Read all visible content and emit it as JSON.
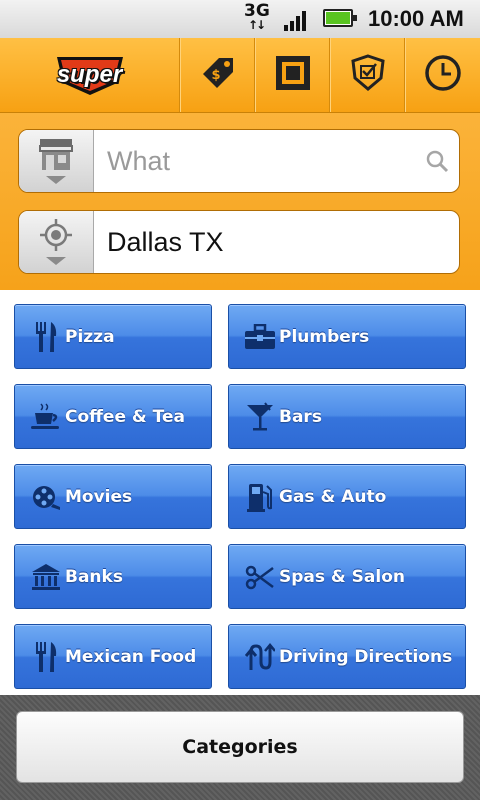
{
  "status_bar": {
    "network": "3G",
    "network_activity": "↑↓",
    "time": "10:00 AM",
    "battery_color": "#59c421"
  },
  "toolbar": {
    "logo_text": "super",
    "buttons": [
      {
        "icon": "price-tag-icon"
      },
      {
        "icon": "barcode-scan-icon"
      },
      {
        "icon": "shield-check-icon"
      },
      {
        "icon": "clock-icon"
      }
    ],
    "accent_color": "#f7a113"
  },
  "search": {
    "what_placeholder": "What",
    "what_icon": "storefront-icon",
    "where_value": "Dallas TX",
    "where_icon": "location-target-icon"
  },
  "categories": [
    {
      "label": "Pizza",
      "icon": "fork-knife-icon"
    },
    {
      "label": "Plumbers",
      "icon": "toolbox-icon"
    },
    {
      "label": "Coffee & Tea",
      "icon": "coffee-cup-icon"
    },
    {
      "label": "Bars",
      "icon": "cocktail-icon"
    },
    {
      "label": "Movies",
      "icon": "film-reel-icon"
    },
    {
      "label": "Gas & Auto",
      "icon": "gas-pump-icon"
    },
    {
      "label": "Banks",
      "icon": "bank-icon"
    },
    {
      "label": "Spas & Salon",
      "icon": "scissors-icon"
    },
    {
      "label": "Mexican Food",
      "icon": "fork-knife-icon"
    },
    {
      "label": "Driving Directions",
      "icon": "directions-icon"
    }
  ],
  "button_color": "#3674dc",
  "bottom": {
    "categories_label": "Categories"
  }
}
